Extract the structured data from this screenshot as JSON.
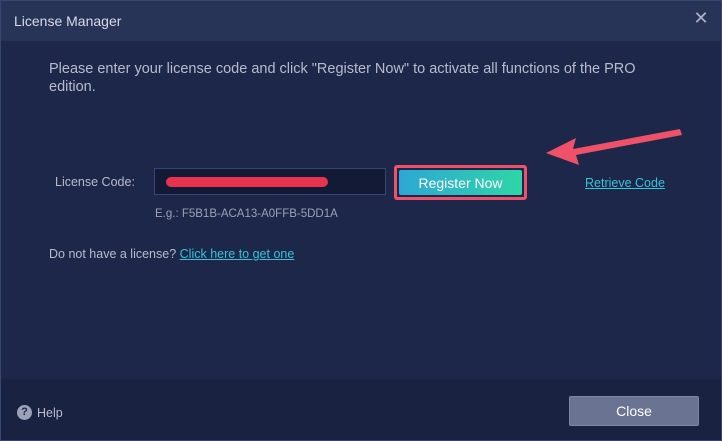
{
  "window": {
    "title": "License Manager",
    "close_icon": "close-icon"
  },
  "main": {
    "instruction": "Please enter your license code and click \"Register Now\" to activate all functions of the PRO edition.",
    "license_label": "License Code:",
    "license_value": "",
    "register_label": "Register Now",
    "retrieve_label": "Retrieve Code",
    "example_text": "E.g.: F5B1B-ACA13-A0FFB-5DD1A",
    "no_license_text": "Do not have a license?",
    "get_one_link": "Click here to get one"
  },
  "footer": {
    "help_label": "Help",
    "close_label": "Close"
  },
  "colors": {
    "background": "#1d2749",
    "accent_start": "#2da7d5",
    "accent_end": "#2fd5a6",
    "link": "#35c4d8",
    "highlight": "#ef5268"
  }
}
